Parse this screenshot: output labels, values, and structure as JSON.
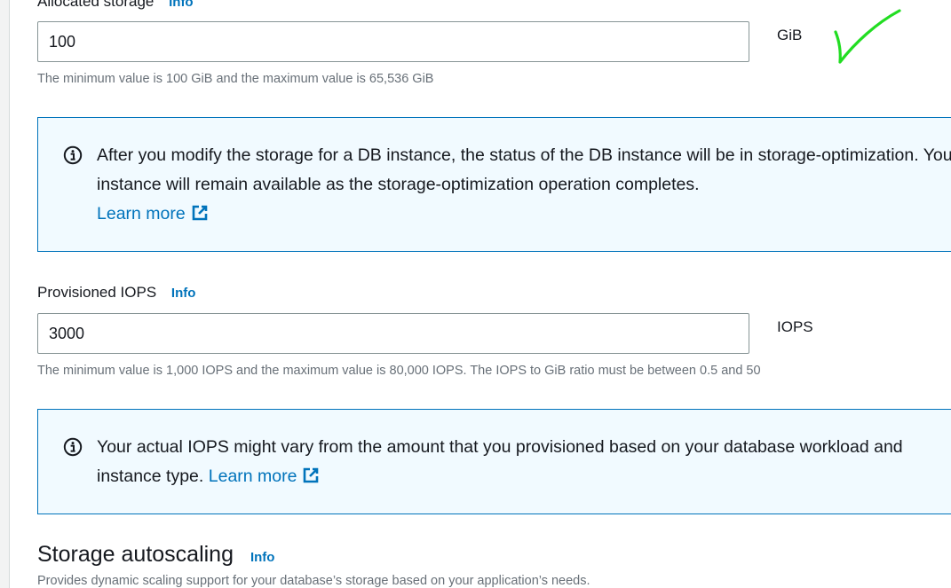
{
  "allocated_storage": {
    "label": "Allocated storage",
    "info": "Info",
    "value": "100",
    "unit": "GiB",
    "hint": "The minimum value is 100 GiB and the maximum value is 65,536 GiB"
  },
  "storage_alert": {
    "text": "After you modify the storage for a DB instance, the status of the DB instance will be in storage-optimization. Your instance will remain available as the storage-optimization operation completes.",
    "link": "Learn more"
  },
  "provisioned_iops": {
    "label": "Provisioned IOPS",
    "info": "Info",
    "value": "3000",
    "unit": "IOPS",
    "hint": "The minimum value is 1,000 IOPS and the maximum value is 80,000 IOPS. The IOPS to GiB ratio must be between 0.5 and 50"
  },
  "iops_alert": {
    "text": "Your actual IOPS might vary from the amount that you provisioned based on your database workload and instance type.",
    "link": "Learn more"
  },
  "storage_autoscaling": {
    "title": "Storage autoscaling",
    "info": "Info",
    "description": "Provides dynamic scaling support for your database’s storage based on your application’s needs."
  },
  "colors": {
    "link": "#0073bb",
    "alert_border": "#0073bb",
    "alert_bg": "#f1faff",
    "annotation_check": "#22dd22"
  },
  "icons": [
    "info-circle-icon",
    "external-link-icon",
    "green-checkmark-annotation"
  ]
}
